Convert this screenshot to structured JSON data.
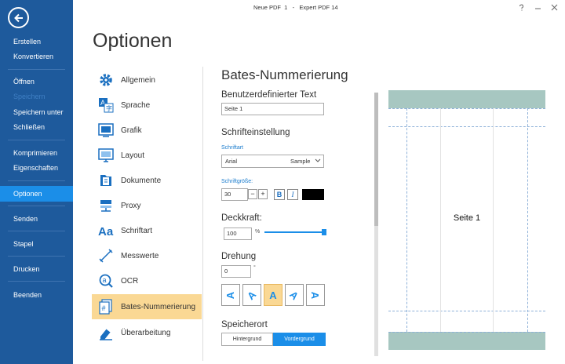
{
  "window": {
    "title": "Neue PDF  1   -   Expert PDF 14"
  },
  "nav": {
    "items": [
      {
        "label": "Erstellen",
        "state": "normal"
      },
      {
        "label": "Konvertieren",
        "state": "normal"
      },
      {
        "label": "Öffnen",
        "state": "normal"
      },
      {
        "label": "Speichern",
        "state": "disabled"
      },
      {
        "label": "Speichern unter",
        "state": "normal"
      },
      {
        "label": "Schließen",
        "state": "normal"
      },
      {
        "label": "Komprimieren",
        "state": "normal"
      },
      {
        "label": "Eigenschaften",
        "state": "normal"
      },
      {
        "label": "Optionen",
        "state": "active"
      },
      {
        "label": "Senden",
        "state": "normal"
      },
      {
        "label": "Stapel",
        "state": "normal"
      },
      {
        "label": "Drucken",
        "state": "normal"
      },
      {
        "label": "Beenden",
        "state": "normal"
      }
    ]
  },
  "page": {
    "title": "Optionen"
  },
  "categories": [
    {
      "label": "Allgemein",
      "icon": "gear-icon"
    },
    {
      "label": "Sprache",
      "icon": "language-icon"
    },
    {
      "label": "Grafik",
      "icon": "graphic-icon"
    },
    {
      "label": "Layout",
      "icon": "layout-icon"
    },
    {
      "label": "Dokumente",
      "icon": "documents-icon"
    },
    {
      "label": "Proxy",
      "icon": "proxy-icon"
    },
    {
      "label": "Schriftart",
      "icon": "font-icon"
    },
    {
      "label": "Messwerte",
      "icon": "measure-icon"
    },
    {
      "label": "OCR",
      "icon": "ocr-icon"
    },
    {
      "label": "Bates-Nummerierung",
      "icon": "bates-icon",
      "active": true
    },
    {
      "label": "Überarbeitung",
      "icon": "revision-icon"
    }
  ],
  "settings": {
    "title": "Bates-Nummerierung",
    "custom_text": {
      "label": "Benutzerdefinierter Text",
      "value": "Seite 1"
    },
    "font_settings": {
      "label": "Schrifteinstellung",
      "font_label": "Schriftart",
      "font_value": "Arial",
      "font_sample": "Sample",
      "size_label": "Schriftgröße:",
      "size_value": "30",
      "minus": "−",
      "plus": "+",
      "bold": "B",
      "italic": "I",
      "color": "#000000"
    },
    "opacity": {
      "label": "Deckkraft:",
      "value": "100",
      "unit": "%",
      "percent": 100
    },
    "rotation": {
      "label": "Drehung",
      "value": "0",
      "unit": "°",
      "options": [
        "A",
        "A",
        "A",
        "A",
        "A"
      ],
      "selected_index": 2
    },
    "location": {
      "label": "Speicherort",
      "options": [
        "Hintergrund",
        "Vordergrund"
      ],
      "selected": "Vordergrund"
    }
  },
  "preview": {
    "text": "Seite 1"
  },
  "colors": {
    "nav_bg": "#1e5a9c",
    "nav_active": "#1b8ee8",
    "highlight": "#fad894",
    "accent": "#1b8ee8",
    "band": "#a7c7c1"
  }
}
